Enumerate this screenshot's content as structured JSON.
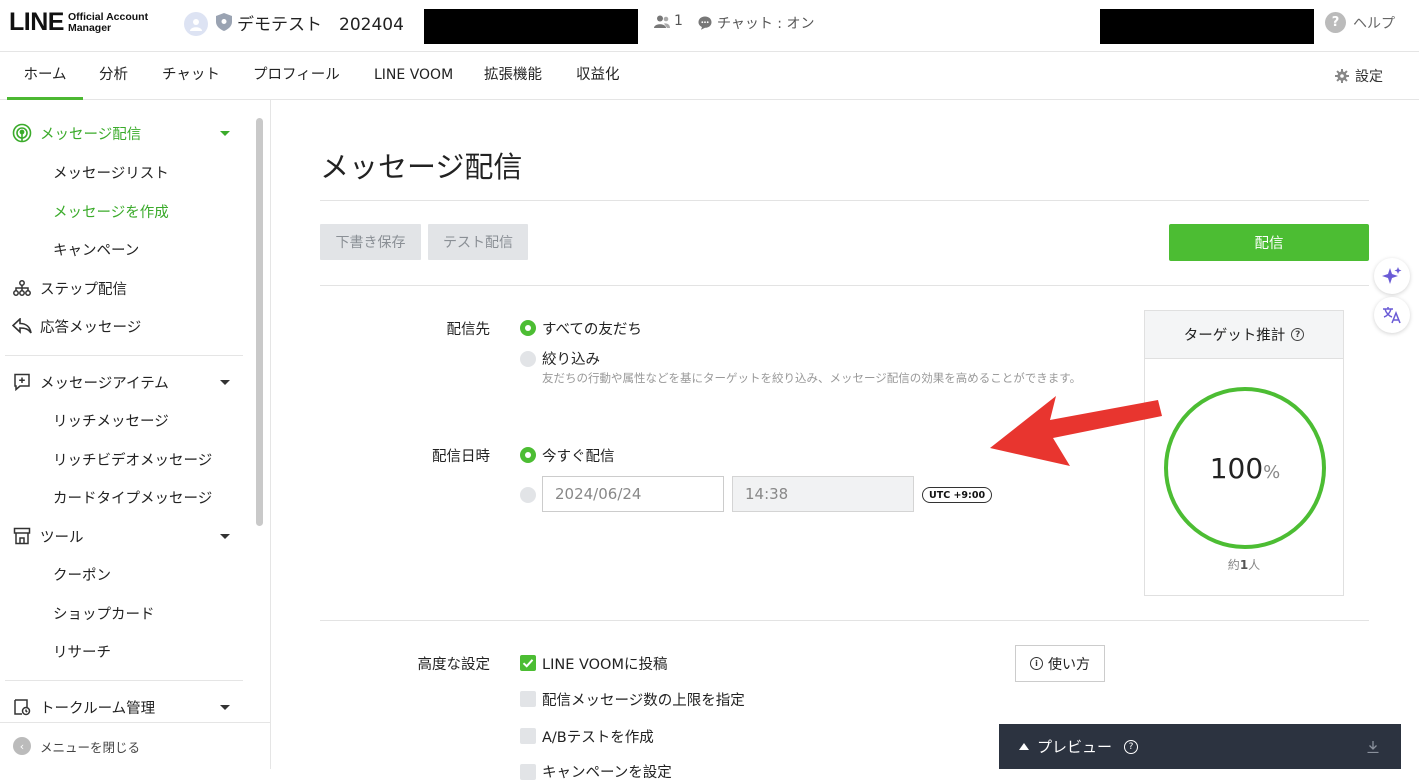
{
  "header": {
    "logo_main": "LINE",
    "logo_sub_line1": "Official Account",
    "logo_sub_line2": "Manager",
    "account_name": "デモテスト　202404",
    "friend_count": "1",
    "chat_status": "チャット : オン",
    "help_label": "ヘルプ"
  },
  "nav": {
    "tabs": [
      {
        "label": "ホーム",
        "active": true
      },
      {
        "label": "分析"
      },
      {
        "label": "チャット"
      },
      {
        "label": "プロフィール"
      },
      {
        "label": "LINE VOOM"
      },
      {
        "label": "拡張機能"
      },
      {
        "label": "収益化"
      }
    ],
    "settings_label": "設定"
  },
  "sidebar": {
    "message_delivery": "メッセージ配信",
    "message_list": "メッセージリスト",
    "create_message": "メッセージを作成",
    "campaign": "キャンペーン",
    "step_delivery": "ステップ配信",
    "response_message": "応答メッセージ",
    "message_items": "メッセージアイテム",
    "rich_message": "リッチメッセージ",
    "rich_video_message": "リッチビデオメッセージ",
    "card_type_message": "カードタイプメッセージ",
    "tools": "ツール",
    "coupon": "クーポン",
    "shop_card": "ショップカード",
    "research": "リサーチ",
    "talk_room": "トークルーム管理",
    "close_menu": "メニューを閉じる"
  },
  "main": {
    "title": "メッセージ配信",
    "draft_button": "下書き保存",
    "test_button": "テスト配信",
    "send_button": "配信",
    "recipients_label": "配信先",
    "all_friends": "すべての友だち",
    "narrow_down": "絞り込み",
    "narrow_hint": "友だちの行動や属性などを基にターゲットを絞り込み、メッセージ配信の効果を高めることができます。",
    "datetime_label": "配信日時",
    "send_now": "今すぐ配信",
    "date_value": "2024/06/24",
    "time_value": "14:38",
    "timezone": "UTC +9:00",
    "target_title": "ターゲット推計",
    "target_value": "100",
    "target_unit": "%",
    "approx_prefix": "約",
    "approx_count": "1",
    "approx_suffix": "人",
    "advanced_label": "高度な設定",
    "post_voom": "LINE VOOMに投稿",
    "limit_count": "配信メッセージ数の上限を指定",
    "ab_test": "A/Bテストを作成",
    "campaign_partial": "キャンペーンを設定",
    "howto_label": "使い方",
    "options": {
      "all_friends_selected": true,
      "send_now_selected": true,
      "post_voom_checked": true,
      "limit_checked": false,
      "ab_checked": false
    }
  },
  "preview": {
    "label": "プレビュー"
  },
  "colors": {
    "brand_green": "#4cbd33",
    "annotation_arrow": "#e8352f",
    "preview_bar": "#2c3340"
  }
}
